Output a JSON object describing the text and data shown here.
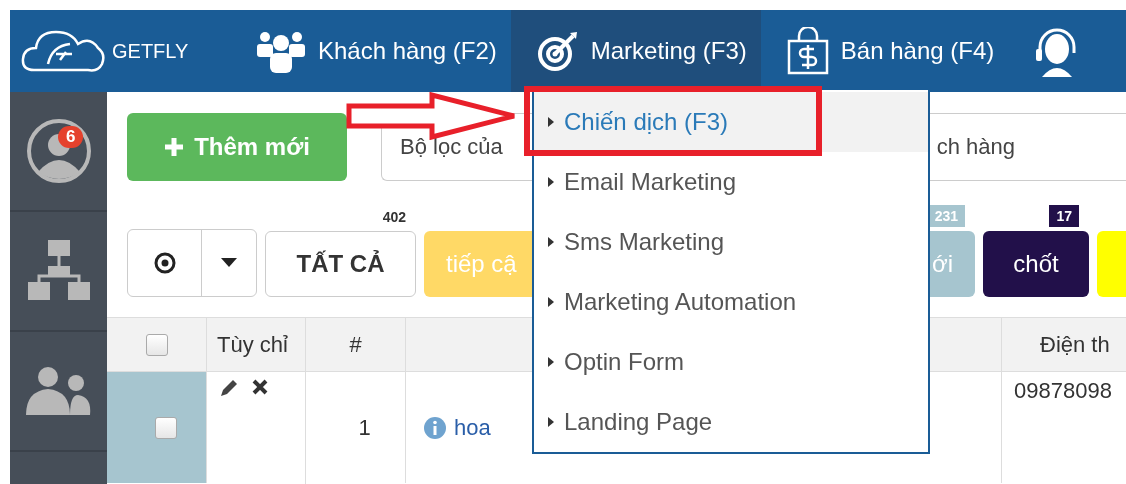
{
  "nav": {
    "logo": "GETFLY",
    "tabs": [
      {
        "label": "Khách hàng (F2)",
        "kind": "people",
        "selected": false
      },
      {
        "label": "Marketing (F3)",
        "kind": "target",
        "selected": true
      },
      {
        "label": "Bán hàng (F4)",
        "kind": "bag",
        "selected": false
      },
      {
        "kind": "headset",
        "selected": false
      }
    ]
  },
  "sidebar": {
    "items": [
      {
        "kind": "avatar",
        "badge": "6"
      },
      {
        "kind": "org"
      },
      {
        "kind": "group"
      },
      {
        "kind": "empty"
      }
    ]
  },
  "toolbar": {
    "add_button": "Thêm mới",
    "filter": {
      "text_start": "Bộ lọc của",
      "text_end": "ch hàng"
    }
  },
  "view_toggle": {
    "selected": true
  },
  "statuses": [
    {
      "kind": "all",
      "label": "TẤT CẢ",
      "count": "402",
      "color": "#ffffff"
    },
    {
      "kind": "stage",
      "label": "tiếp cậ",
      "color": "#ffd966"
    },
    {
      "kind": "gap"
    },
    {
      "kind": "stage",
      "label": "ới",
      "count": "231",
      "color": "#a6c5cf"
    },
    {
      "kind": "stage",
      "label": "chốt",
      "count": "17",
      "color": "#22104a"
    },
    {
      "kind": "stage",
      "color": "#ffff00"
    }
  ],
  "table": {
    "header_checked": false,
    "columns": [
      "Tùy chỉ",
      "#",
      "Điện th"
    ],
    "rows": [
      {
        "checked": false,
        "number": "1",
        "name": "hoa",
        "phone": "09878098"
      }
    ]
  },
  "menu": {
    "items": [
      {
        "label": "Chiến dịch (F3)",
        "selected": true
      },
      {
        "label": "Email Marketing",
        "selected": false
      },
      {
        "label": "Sms Marketing",
        "selected": false
      },
      {
        "label": "Marketing Automation",
        "selected": false
      },
      {
        "label": "Optin Form",
        "selected": false
      },
      {
        "label": "Landing Page",
        "selected": false
      }
    ]
  }
}
